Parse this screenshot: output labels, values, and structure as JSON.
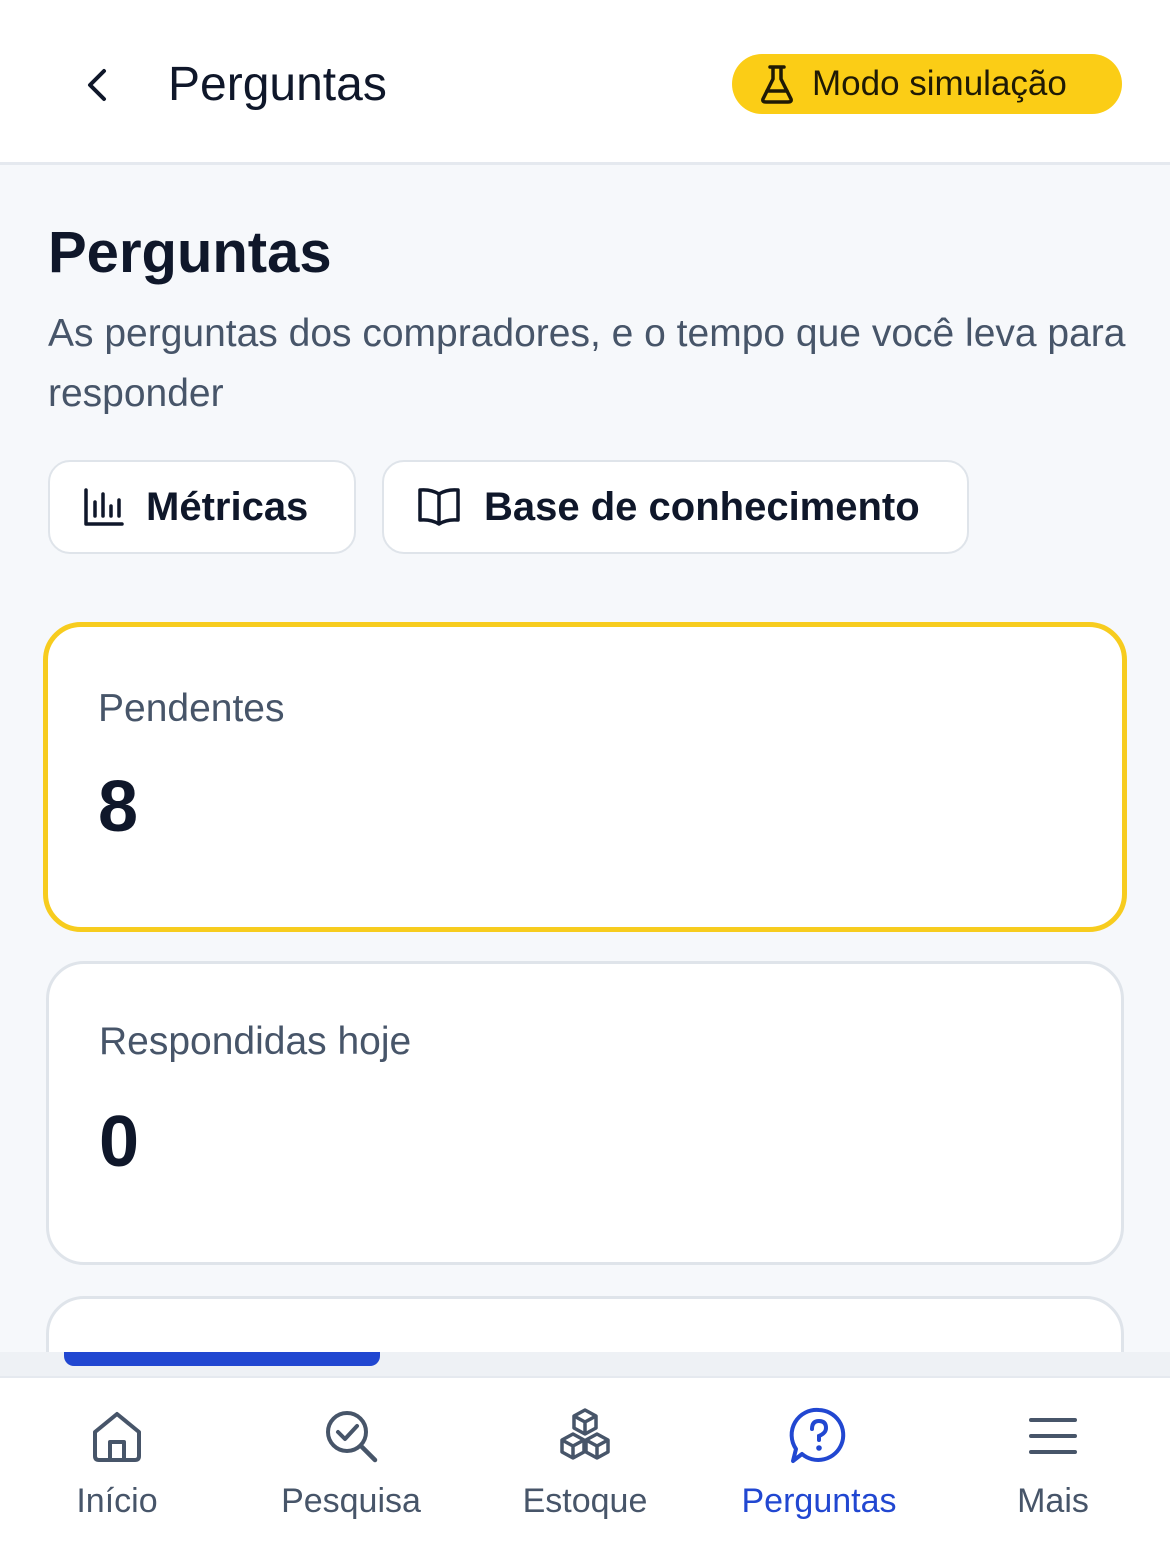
{
  "header": {
    "title": "Perguntas",
    "badge_label": "Modo simulação",
    "badge_color": "#fbcd16"
  },
  "main": {
    "title": "Perguntas",
    "subtitle": "As perguntas dos compradores, e o tempo que você leva para responder",
    "actions": [
      {
        "label": "Métricas",
        "icon": "bar-chart-icon"
      },
      {
        "label": "Base de conhecimento",
        "icon": "book-icon"
      }
    ],
    "cards": [
      {
        "label": "Pendentes",
        "value": "8",
        "highlight_color": "#f7cc1e"
      },
      {
        "label": "Respondidas hoje",
        "value": "0"
      }
    ]
  },
  "bottom_nav": {
    "active_color": "#2147d1",
    "items": [
      {
        "label": "Início",
        "icon": "home-icon"
      },
      {
        "label": "Pesquisa",
        "icon": "search-check-icon"
      },
      {
        "label": "Estoque",
        "icon": "boxes-icon"
      },
      {
        "label": "Perguntas",
        "icon": "question-bubble-icon",
        "active": true
      },
      {
        "label": "Mais",
        "icon": "menu-icon"
      }
    ]
  }
}
